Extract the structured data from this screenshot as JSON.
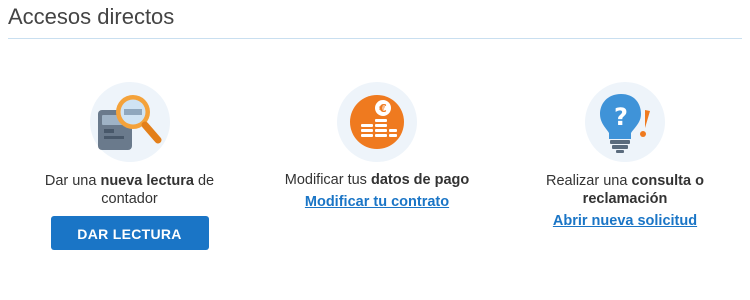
{
  "header": {
    "title": "Accesos directos"
  },
  "shortcuts": [
    {
      "icon": "meter-magnifier-icon",
      "text_before": "Dar una ",
      "text_bold": "nueva lectura",
      "text_after": " de contador",
      "action": "DAR LECTURA"
    },
    {
      "icon": "coins-euro-icon",
      "text_before": "Modificar tus ",
      "text_bold": "datos de pago",
      "text_after": "",
      "action": "Modificar tu contrato"
    },
    {
      "icon": "lightbulb-question-icon",
      "text_before": "Realizar una ",
      "text_bold": "consulta o reclamación",
      "text_after": "",
      "action": "Abrir nueva solicitud"
    }
  ],
  "colors": {
    "accent": "#1a75c6",
    "icon_bg": "#eef4fa",
    "rule": "#c9dff0"
  }
}
